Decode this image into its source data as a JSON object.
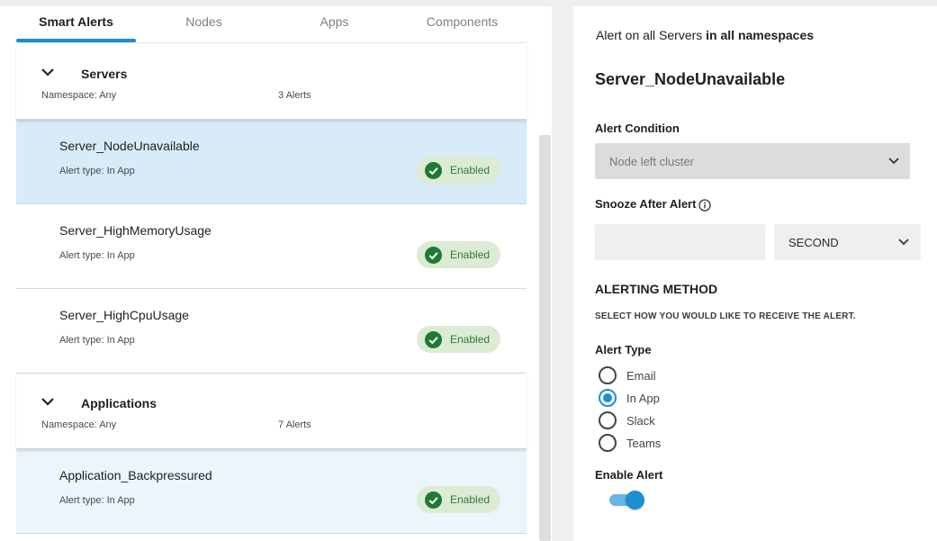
{
  "tabs": [
    {
      "label": "Smart Alerts",
      "active": true
    },
    {
      "label": "Nodes",
      "active": false
    },
    {
      "label": "Apps",
      "active": false
    },
    {
      "label": "Components",
      "active": false
    }
  ],
  "groups": [
    {
      "title": "Servers",
      "namespace": "Namespace: Any",
      "count": "3 Alerts",
      "alerts": [
        {
          "name": "Server_NodeUnavailable",
          "type": "Alert type: In App",
          "status": "Enabled",
          "selected": true
        },
        {
          "name": "Server_HighMemoryUsage",
          "type": "Alert type: In App",
          "status": "Enabled",
          "selected": false
        },
        {
          "name": "Server_HighCpuUsage",
          "type": "Alert type: In App",
          "status": "Enabled",
          "selected": false
        }
      ]
    },
    {
      "title": "Applications",
      "namespace": "Namespace: Any",
      "count": "7 Alerts",
      "alerts": [
        {
          "name": "Application_Backpressured",
          "type": "Alert type: In App",
          "status": "Enabled",
          "selected": false
        }
      ]
    }
  ],
  "detail": {
    "heading_prefix": "Alert on all Servers",
    "heading_suffix": "in all namespaces",
    "title": "Server_NodeUnavailable",
    "condition_label": "Alert Condition",
    "condition_value": "Node left cluster",
    "snooze_label": "Snooze After Alert",
    "snooze_value": "",
    "snooze_unit": "SECOND",
    "method_title": "ALERTING METHOD",
    "method_subtitle": "SELECT HOW YOU WOULD LIKE TO RECEIVE THE ALERT.",
    "alert_type_label": "Alert Type",
    "alert_types": [
      {
        "label": "Email",
        "checked": false
      },
      {
        "label": "In App",
        "checked": true
      },
      {
        "label": "Slack",
        "checked": false
      },
      {
        "label": "Teams",
        "checked": false
      }
    ],
    "enable_label": "Enable Alert",
    "enabled": true
  },
  "colors": {
    "accent": "#1b8fd1",
    "selected_row": "#d7ebf8",
    "badge_bg": "#dcebd3",
    "badge_check": "#1e7a34",
    "badge_text": "#2f7a3a"
  },
  "icons": {
    "group_toggle": "chevron-down-icon",
    "status": "check-circle-icon",
    "info": "info-icon",
    "dropdown": "chevron-down-icon"
  }
}
